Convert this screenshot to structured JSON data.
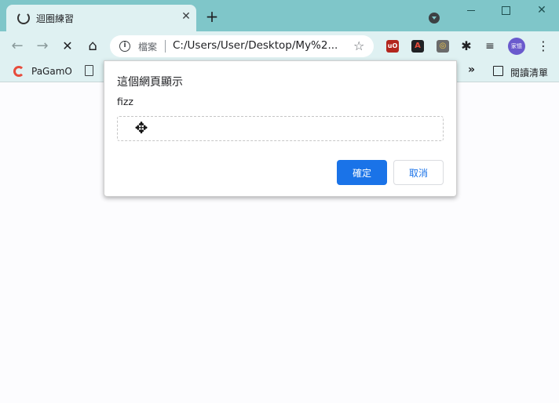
{
  "browser": {
    "tab": {
      "title": "迴圈練習",
      "close": "✕"
    },
    "new_tab": "+",
    "window_controls": {
      "close": "✕"
    },
    "toolbar": {
      "back": "←",
      "forward": "→",
      "stop": "✕",
      "home": "⌂",
      "omnibox": {
        "info": "i",
        "label": "檔案",
        "url": "C:/Users/User/Desktop/My%2..."
      },
      "star": "☆",
      "extensions": {
        "ublock": "uO",
        "a": "A",
        "c": "◎",
        "puzzle": "✱",
        "playlist": "≡"
      },
      "avatar": "家憶",
      "menu": "⋮"
    },
    "bookmarks": {
      "items": [
        {
          "label": "PaGamO"
        }
      ],
      "more": "»",
      "reading_list": "閱讀清單"
    }
  },
  "dialog": {
    "title": "這個網頁顯示",
    "message": "fizz",
    "input_value": "",
    "ok_label": "確定",
    "cancel_label": "取消",
    "cursor": "✥"
  },
  "colors": {
    "titlebar": "#7fc6c9",
    "toolbar": "#dff1f2",
    "accent": "#1a73e8"
  }
}
